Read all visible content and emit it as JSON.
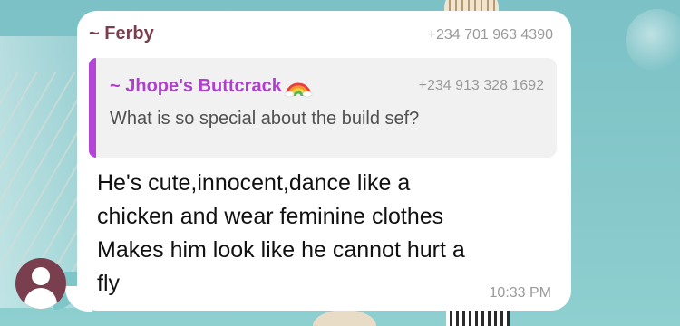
{
  "message": {
    "sender_name": "~ Ferby",
    "sender_phone": "+234 701 963 4390",
    "reply": {
      "name": "~ Jhope's Buttcrack",
      "emoji_icon": "rainbow-icon",
      "phone": "+234 913 328 1692",
      "text": "What is so special about the build sef?"
    },
    "body": "He's cute,innocent,dance like a\nchicken and wear feminine clothes\nMakes him look like he cannot hurt a\nfly",
    "time": "10:33 PM"
  },
  "colors": {
    "sender_name": "#7a3f4f",
    "reply_name": "#b03fd0",
    "reply_bar": "#b445d8",
    "avatar": "#7a3f4f",
    "wallpaper": "#7fc3c7"
  }
}
